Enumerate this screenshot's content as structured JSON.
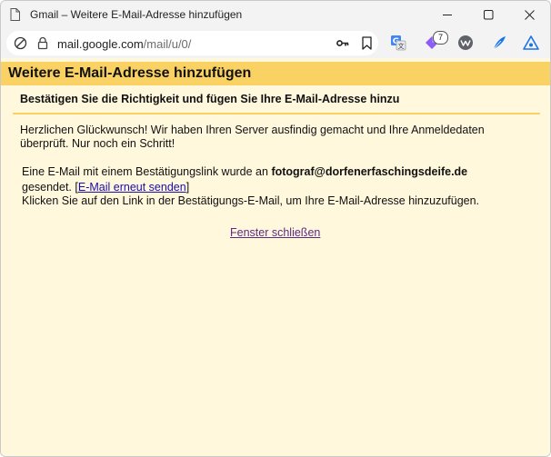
{
  "window": {
    "title": "Gmail – Weitere E-Mail-Adresse hinzufügen",
    "controls": [
      "minimize-icon",
      "maximize-icon",
      "close-icon"
    ]
  },
  "address_bar": {
    "url_domain": "mail.google.com",
    "url_path": "/mail/u/0/",
    "icons": [
      "site-info-icon",
      "lock-icon",
      "key-icon",
      "bookmark-icon"
    ]
  },
  "extensions": {
    "icons": [
      "translate-icon",
      "gem-extension-icon",
      "w-extension-icon",
      "feather-extension-icon",
      "triangle-extension-icon"
    ],
    "badge_count": "7"
  },
  "page": {
    "heading": "Weitere E-Mail-Adresse hinzufügen",
    "subtitle": "Bestätigen Sie die Richtigkeit und fügen Sie Ihre E-Mail-Adresse hinzu",
    "congrats_line1": "Herzlichen Glückwunsch! Wir haben Ihren Server ausfindig gemacht und Ihre Anmeldedaten",
    "congrats_line2": "überprüft. Nur noch ein Schritt!",
    "sent_prefix": "Eine E-Mail mit einem Bestätigungslink wurde an ",
    "email": "fotograf@dorfenerfaschingsdeife.de",
    "sent_suffix": "gesendet. [",
    "resend_link": "E-Mail erneut senden",
    "bracket_close": "]",
    "instruction": "Klicken Sie auf den Link in der Bestätigungs-E-Mail, um Ihre E-Mail-Adresse hinzuzufügen.",
    "close_link": "Fenster schließen"
  },
  "colors": {
    "header_bg": "#fad163",
    "content_bg": "#fff8dd",
    "link": "#1a0dab",
    "visited_link": "#5b2a86"
  }
}
